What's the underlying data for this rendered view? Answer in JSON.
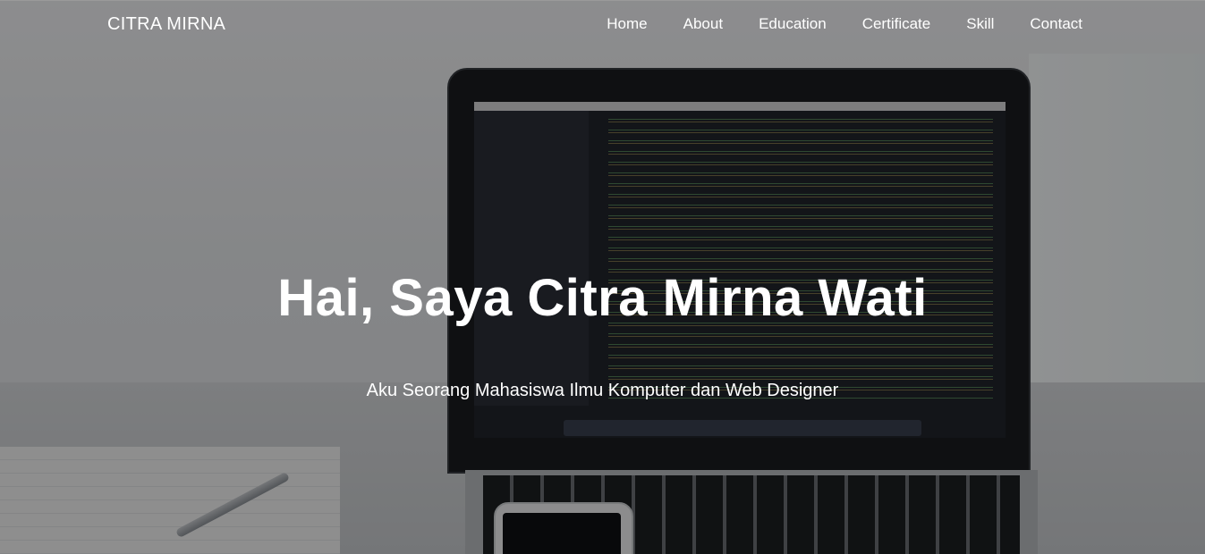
{
  "navbar": {
    "brand": "CITRA MIRNA",
    "links": [
      "Home",
      "About",
      "Education",
      "Certificate",
      "Skill",
      "Contact"
    ]
  },
  "hero": {
    "title": "Hai, Saya Citra Mirna Wati",
    "subtitle": "Aku Seorang Mahasiswa Ilmu Komputer dan Web Designer",
    "overlay_color": "#000000"
  }
}
